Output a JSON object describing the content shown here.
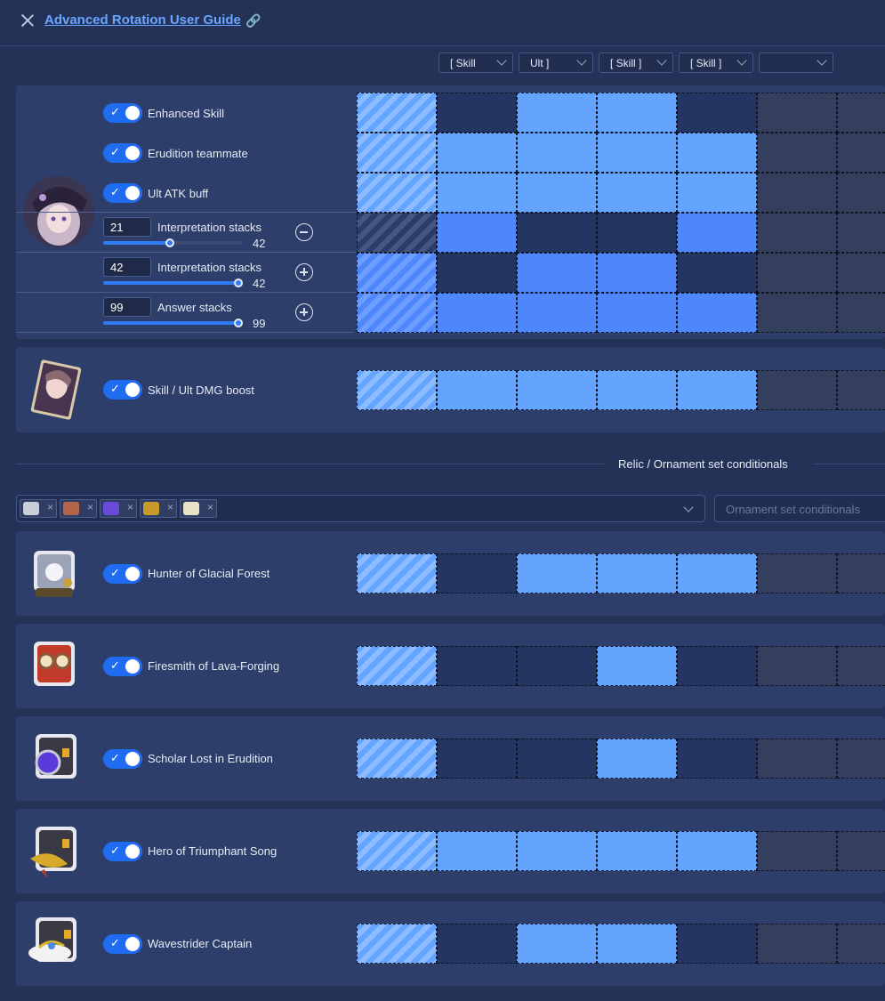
{
  "header": {
    "title": "Advanced Rotation User Guide",
    "link_icon": "link-icon"
  },
  "rotation_dropdowns": [
    "[ Skill",
    "Ult ]",
    "[ Skill ]",
    "[ Skill ]",
    ""
  ],
  "character": {
    "avatar_icon": "character-portrait",
    "toggles": [
      "Enhanced Skill",
      "Erudition teammate",
      "Ult ATK buff"
    ],
    "sliders": [
      {
        "value": "21",
        "label": "Interpretation stacks",
        "max": "42",
        "fill": 0.5,
        "button": "minus-circle-icon"
      },
      {
        "value": "42",
        "label": "Interpretation stacks",
        "max": "42",
        "fill": 1.0,
        "button": "plus-circle-icon"
      },
      {
        "value": "99",
        "label": "Answer stacks",
        "max": "99",
        "fill": 1.0,
        "button": "plus-circle-icon"
      }
    ]
  },
  "lightcone": {
    "icon": "light-cone-card",
    "toggle": "Skill / Ult DMG boost"
  },
  "relic_section": {
    "divider_label": "Relic / Ornament set conditionals",
    "selected_tags": [
      "hunter-set-icon",
      "firesmith-set-icon",
      "scholar-set-icon",
      "hero-set-icon",
      "wavestrider-set-icon"
    ],
    "ornament_placeholder": "Ornament set conditionals"
  },
  "relics": [
    {
      "name": "Hunter of Glacial Forest",
      "icon": "hunter-relic-icon"
    },
    {
      "name": "Firesmith of Lava-Forging",
      "icon": "firesmith-relic-icon"
    },
    {
      "name": "Scholar Lost in Erudition",
      "icon": "scholar-relic-icon"
    },
    {
      "name": "Hero of Triumphant Song",
      "icon": "hero-relic-icon"
    },
    {
      "name": "Wavestrider Captain",
      "icon": "wavestrider-relic-icon"
    }
  ],
  "grid_states": {
    "enhanced_skill": [
      "h1",
      "c0",
      "c1",
      "c1",
      "c0",
      "c3",
      "c3"
    ],
    "erudition_teammate": [
      "h1",
      "c1",
      "c1",
      "c1",
      "c1",
      "c3",
      "c3"
    ],
    "ult_atk_buff": [
      "h1",
      "c1",
      "c1",
      "c1",
      "c1",
      "c3",
      "c3"
    ],
    "interp_stacks_1": [
      "h0",
      "c2",
      "c0",
      "c0",
      "c2",
      "c3",
      "c3"
    ],
    "interp_stacks_2": [
      "h2",
      "c0",
      "c2",
      "c2",
      "c0",
      "c3",
      "c3"
    ],
    "answer_stacks": [
      "h2",
      "c2",
      "c2",
      "c2",
      "c2",
      "c3",
      "c3"
    ],
    "skill_ult_dmg_boost": [
      "h1",
      "c1",
      "c1",
      "c1",
      "c1",
      "c3",
      "c3"
    ],
    "hunter": [
      "h1",
      "c0",
      "c1",
      "c1",
      "c1",
      "c3",
      "c3"
    ],
    "firesmith": [
      "h1",
      "c0",
      "c0",
      "c1",
      "c0",
      "c3",
      "c3"
    ],
    "scholar": [
      "h1",
      "c0",
      "c0",
      "c1",
      "c0",
      "c3",
      "c3"
    ],
    "hero": [
      "h1",
      "c1",
      "c1",
      "c1",
      "c1",
      "c3",
      "c3"
    ],
    "wavestrider": [
      "h1",
      "c0",
      "c1",
      "c1",
      "c0",
      "c3",
      "c3"
    ]
  }
}
